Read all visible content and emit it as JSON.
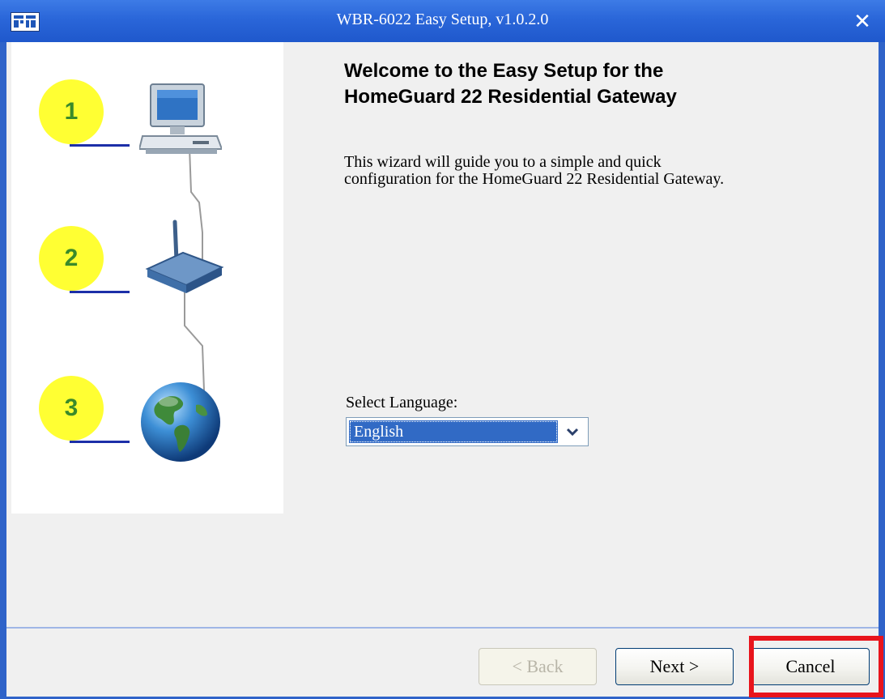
{
  "window": {
    "title": "WBR-6022 Easy Setup, v1.0.2.0",
    "close_glyph": "✕"
  },
  "steps": [
    {
      "number": "1",
      "icon": "computer-icon"
    },
    {
      "number": "2",
      "icon": "router-icon"
    },
    {
      "number": "3",
      "icon": "globe-icon"
    }
  ],
  "main": {
    "heading": "Welcome to the Easy Setup for the\nHomeGuard 22 Residential Gateway",
    "intro": "This wizard will guide you to a simple and quick configuration for the HomeGuard 22 Residential Gateway."
  },
  "language": {
    "label": "Select Language:",
    "selected": "English"
  },
  "footer": {
    "back_label": "< Back",
    "next_label": "Next >",
    "cancel_label": "Cancel"
  },
  "colors": {
    "title_bar": "#2a66d9",
    "badge": "#ffff33",
    "badge_text": "#3a8a2a",
    "highlight": "#e8141c",
    "selection": "#316ac5"
  }
}
